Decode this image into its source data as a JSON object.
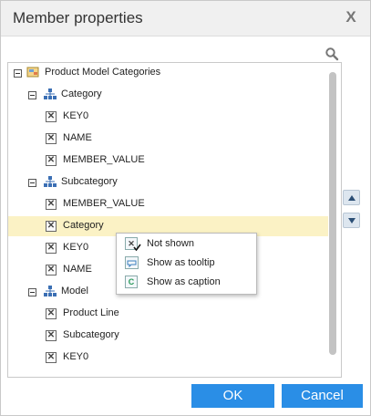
{
  "dialog": {
    "title": "Member properties",
    "close_glyph": "X"
  },
  "tree": {
    "root": "Product Model Categories",
    "groups": [
      {
        "label": "Category",
        "items": [
          "KEY0",
          "NAME",
          "MEMBER_VALUE"
        ]
      },
      {
        "label": "Subcategory",
        "items": [
          "MEMBER_VALUE",
          "Category",
          "KEY0",
          "NAME"
        ]
      },
      {
        "label": "Model",
        "items": [
          "Product Line",
          "Subcategory",
          "KEY0"
        ]
      }
    ],
    "selected_item": "Category"
  },
  "context_menu": {
    "items": [
      {
        "label": "Not shown",
        "icon": "x-icon",
        "checked": true
      },
      {
        "label": "Show as tooltip",
        "icon": "tooltip-icon",
        "checked": false
      },
      {
        "label": "Show as caption",
        "icon": "caption-icon",
        "checked": false
      }
    ]
  },
  "buttons": {
    "ok": "OK",
    "cancel": "Cancel"
  },
  "colors": {
    "accent": "#2a8ee6",
    "highlight": "#fbf2c5"
  }
}
